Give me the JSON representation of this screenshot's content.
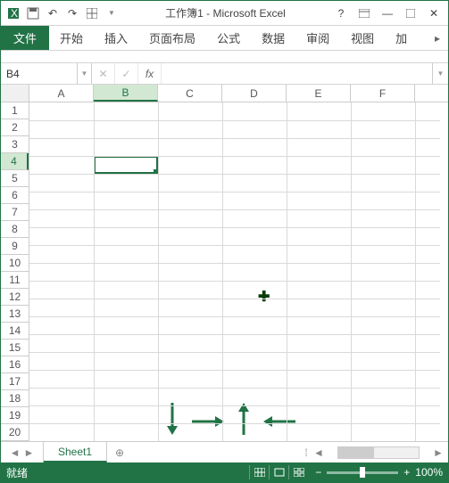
{
  "titlebar": {
    "title": "工作簿1 - Microsoft Excel"
  },
  "tabs": {
    "file": "文件",
    "items": [
      "开始",
      "插入",
      "页面布局",
      "公式",
      "数据",
      "审阅",
      "视图",
      "加"
    ]
  },
  "formula_bar": {
    "name_box": "B4",
    "fx_label": "fx",
    "value": ""
  },
  "grid": {
    "columns": [
      "A",
      "B",
      "C",
      "D",
      "E",
      "F"
    ],
    "rows": [
      "1",
      "2",
      "3",
      "4",
      "5",
      "6",
      "7",
      "8",
      "9",
      "10",
      "11",
      "12",
      "13",
      "14",
      "15",
      "16",
      "17",
      "18",
      "19",
      "20"
    ],
    "selected_col": "B",
    "selected_row": "4"
  },
  "sheet_tabs": {
    "active": "Sheet1"
  },
  "status": {
    "ready": "就绪",
    "zoom": "100%"
  }
}
